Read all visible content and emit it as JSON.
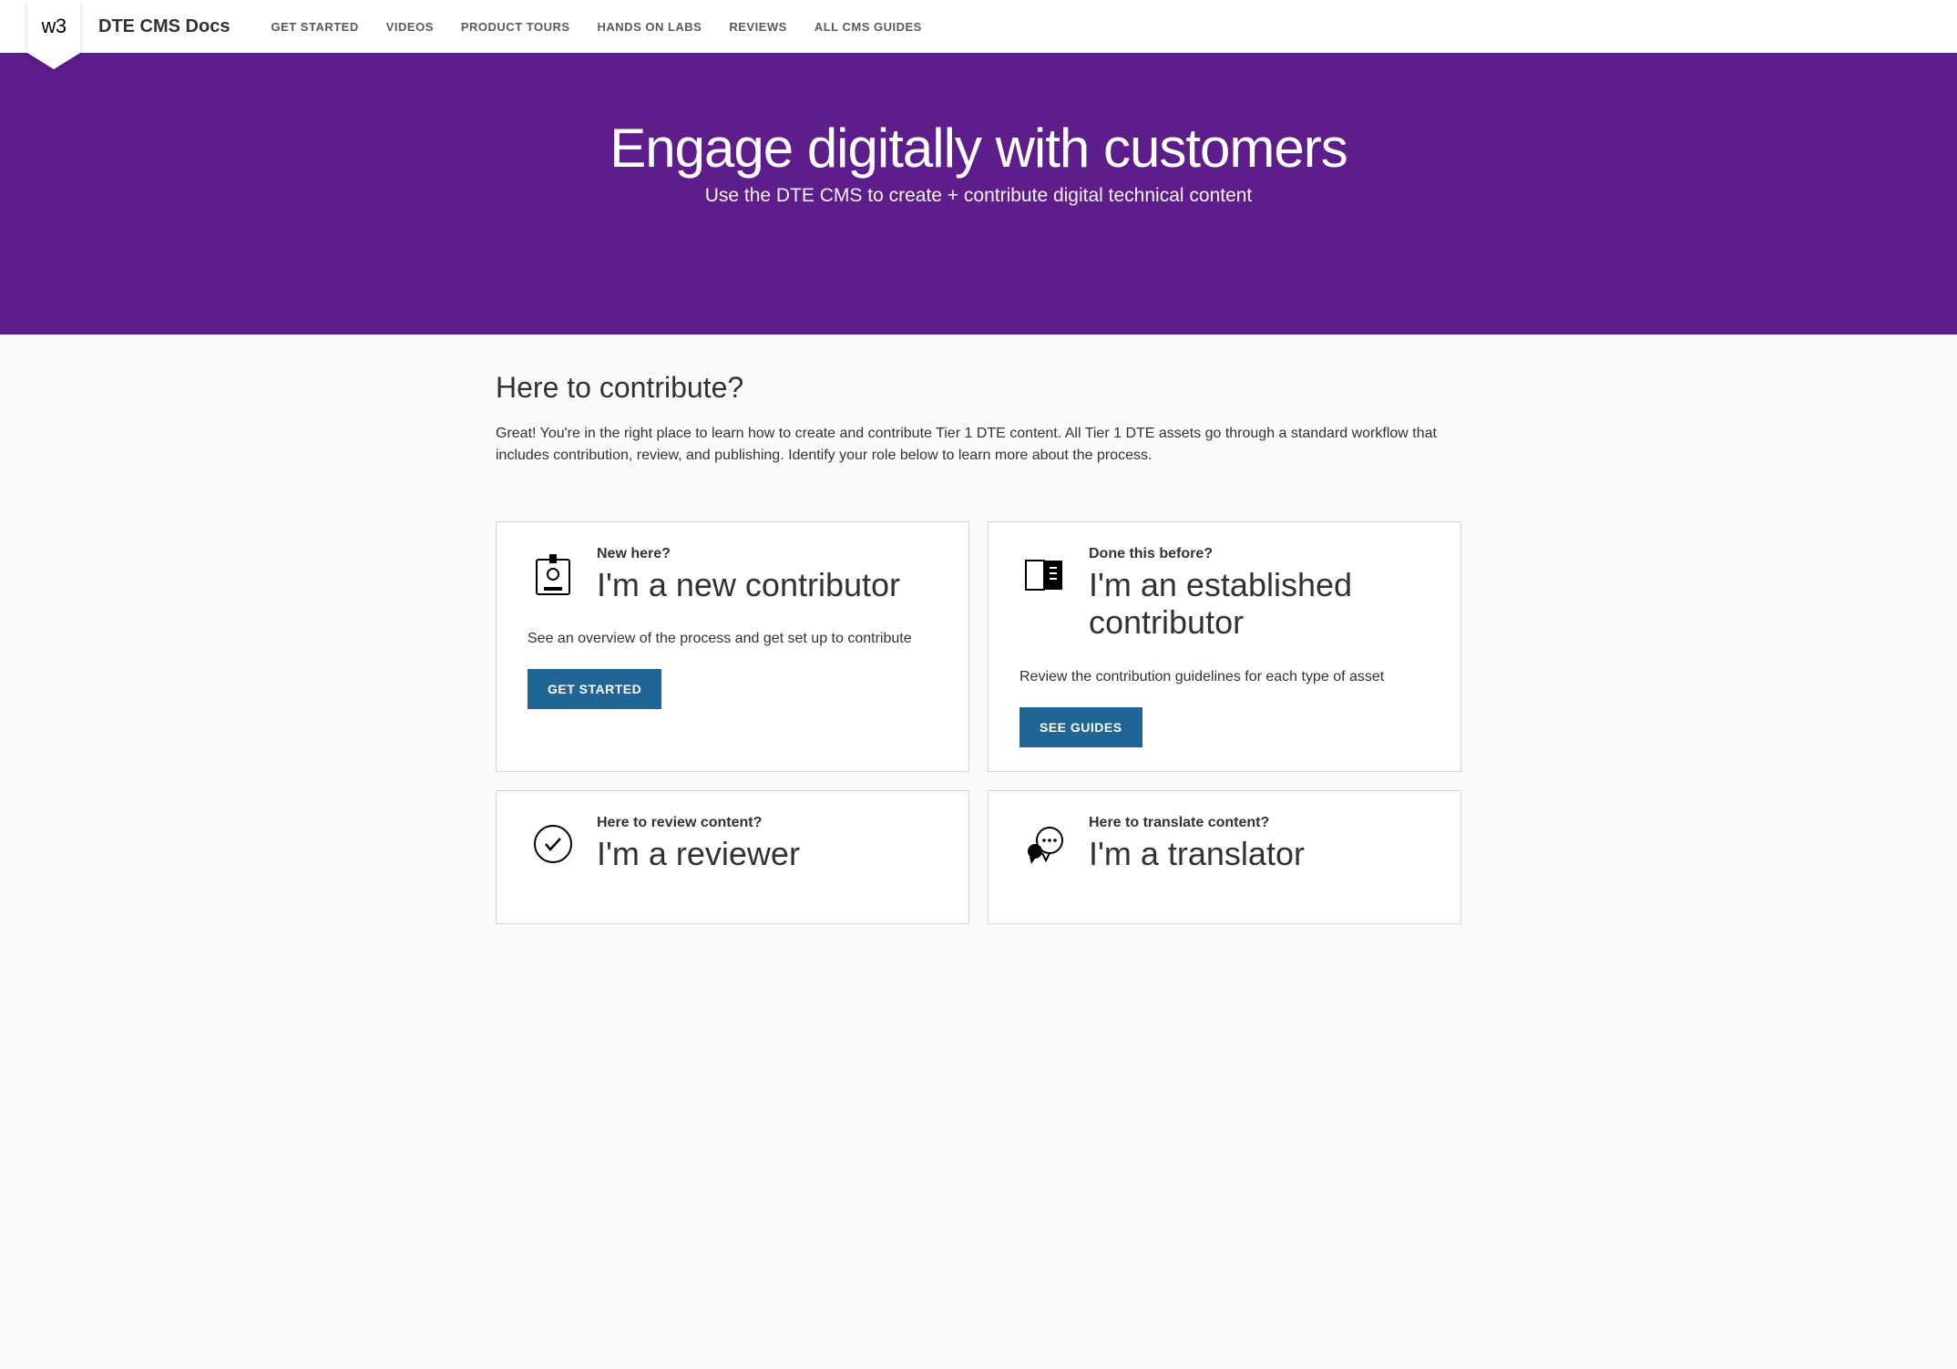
{
  "header": {
    "logo_text": "w3",
    "site_title": "DTE CMS Docs",
    "nav": [
      "GET STARTED",
      "VIDEOS",
      "PRODUCT TOURS",
      "HANDS ON LABS",
      "REVIEWS",
      "ALL CMS GUIDES"
    ]
  },
  "hero": {
    "title": "Engage digitally with customers",
    "subtitle": "Use the DTE CMS to create + contribute digital technical content"
  },
  "section": {
    "title": "Here to contribute?",
    "description": "Great! You're in the right place to learn how to create and contribute Tier 1 DTE content. All Tier 1 DTE assets go through a standard workflow that includes contribution, review, and publishing. Identify your role below to learn more about the process."
  },
  "cards": [
    {
      "eyebrow": "New here?",
      "title": "I'm a new contributor",
      "description": "See an overview of the process and get set up to contribute",
      "button": "GET STARTED"
    },
    {
      "eyebrow": "Done this before?",
      "title": "I'm an established contributor",
      "description": "Review the contribution guidelines for each type of asset",
      "button": "SEE GUIDES"
    },
    {
      "eyebrow": "Here to review content?",
      "title": "I'm a reviewer"
    },
    {
      "eyebrow": "Here to translate content?",
      "title": "I'm a translator"
    }
  ]
}
